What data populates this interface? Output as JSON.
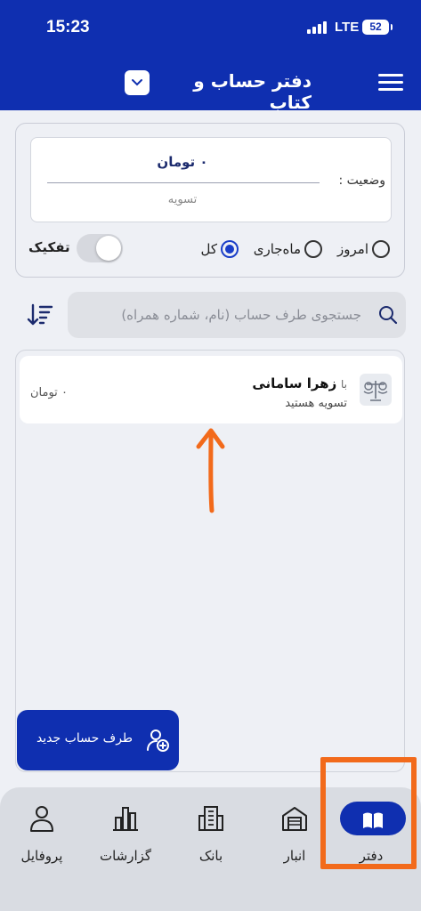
{
  "status_bar": {
    "time": "15:23",
    "network": "LTE",
    "battery": "52"
  },
  "header": {
    "title": "دفتر حساب و کتاب"
  },
  "summary": {
    "status_label": "وضعیت :",
    "amount": "۰ تومان",
    "settle_text": "تسویه"
  },
  "filters": {
    "today": "امروز",
    "current_month": "ماه‌جاری",
    "all": "کل",
    "selected": "all",
    "breakdown_label": "تفکیک",
    "breakdown_on": false
  },
  "search": {
    "placeholder": "جستجوی طرف حساب (نام، شماره همراه)"
  },
  "list": {
    "items": [
      {
        "prefix": "با",
        "name": "زهرا سامانی",
        "subtitle": "تسویه هستید",
        "amount": "۰ تومان"
      }
    ]
  },
  "fab": {
    "label": "طرف حساب جدید"
  },
  "bottom_nav": {
    "items": [
      {
        "key": "ledger",
        "label": "دفتر",
        "icon": "book-icon",
        "active": true
      },
      {
        "key": "warehouse",
        "label": "انبار",
        "icon": "warehouse-icon",
        "active": false
      },
      {
        "key": "bank",
        "label": "بانک",
        "icon": "bank-building-icon",
        "active": false
      },
      {
        "key": "reports",
        "label": "گزارشات",
        "icon": "bar-chart-icon",
        "active": false
      },
      {
        "key": "profile",
        "label": "پروفایل",
        "icon": "person-icon",
        "active": false
      }
    ]
  },
  "colors": {
    "primary": "#0f2fb0",
    "accent_radio": "#1a3ec8",
    "annotation": "#f26a1b",
    "background": "#eef0f5"
  }
}
